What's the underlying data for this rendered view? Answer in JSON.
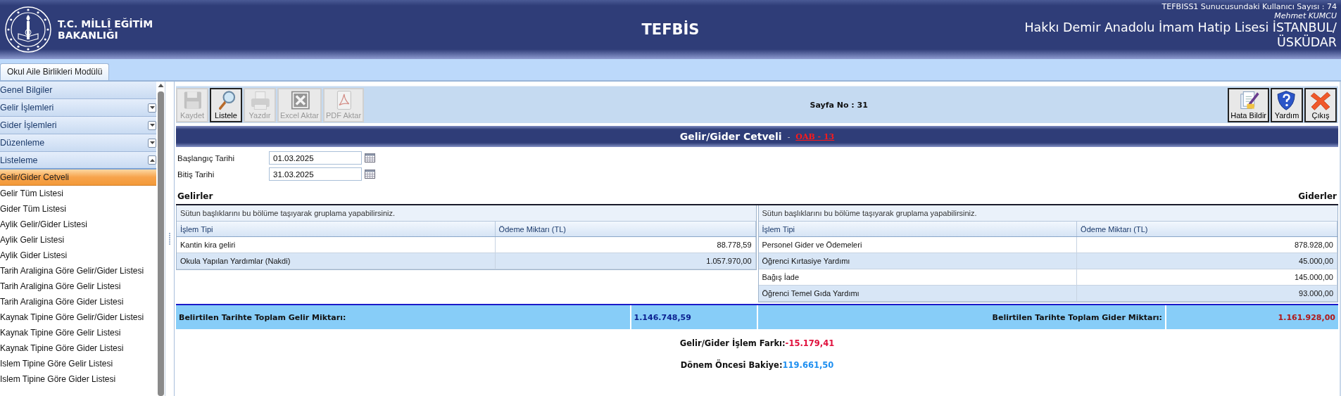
{
  "header": {
    "logo_lines": [
      "T.C. MİLLÎ EĞİTİM",
      "BAKANLIĞI"
    ],
    "app_title": "TEFBİS",
    "user_count": "TEFBISS1 Sunucusundaki Kullanıcı Sayısı : 74",
    "user": "Mehmet KUMCU",
    "school_lines": [
      "Hakkı Demir Anadolu İmam Hatip Lisesi İSTANBUL/",
      "ÜSKÜDAR"
    ]
  },
  "tabs": [
    {
      "label": "Okul Aile Birlikleri Modülü",
      "selected": true
    }
  ],
  "sidebar": {
    "sections": [
      {
        "label": "Genel Bilgiler",
        "kind": "link",
        "expanded": false
      },
      {
        "label": "Gelir İşlemleri",
        "kind": "group",
        "expanded": false
      },
      {
        "label": "Gider İşlemleri",
        "kind": "group",
        "expanded": false
      },
      {
        "label": "Düzenleme",
        "kind": "group",
        "expanded": false
      },
      {
        "label": "Listeleme",
        "kind": "group",
        "expanded": true,
        "items": [
          {
            "label": "Gelir/Gider Cetveli",
            "selected": true
          },
          {
            "label": "Gelir Tüm Listesi",
            "selected": false
          },
          {
            "label": "Gider Tüm Listesi",
            "selected": false
          },
          {
            "label": "Aylik Gelir/Gider Listesi",
            "selected": false
          },
          {
            "label": "Aylik Gelir Listesi",
            "selected": false
          },
          {
            "label": "Aylik Gider Listesi",
            "selected": false
          },
          {
            "label": "Tarih Araligina Göre Gelir/Gider Listesi",
            "selected": false
          },
          {
            "label": "Tarih Araligina Göre Gelir Listesi",
            "selected": false
          },
          {
            "label": "Tarih Araligina Göre Gider Listesi",
            "selected": false
          },
          {
            "label": "Kaynak Tipine Göre Gelir/Gider Listesi",
            "selected": false
          },
          {
            "label": "Kaynak Tipine Göre Gelir Listesi",
            "selected": false
          },
          {
            "label": "Kaynak Tipine Göre Gider Listesi",
            "selected": false
          },
          {
            "label": "Islem Tipine Göre Gelir Listesi",
            "selected": false
          },
          {
            "label": "Islem Tipine Göre Gider Listesi",
            "selected": false
          }
        ]
      }
    ]
  },
  "toolbar": {
    "left_buttons": [
      {
        "label": "Kaydet",
        "kind": "save",
        "disabled": true
      },
      {
        "label": "Listele",
        "kind": "list",
        "disabled": false
      },
      {
        "label": "Yazdır",
        "kind": "print",
        "disabled": true
      },
      {
        "label": "Excel Aktar",
        "kind": "excel",
        "disabled": true
      },
      {
        "label": "PDF Aktar",
        "kind": "pdf",
        "disabled": true
      }
    ],
    "page_no": "Sayfa No : 31",
    "right_buttons": [
      {
        "label": "Hata Bildir",
        "kind": "report",
        "disabled": false
      },
      {
        "label": "Yardım",
        "kind": "help",
        "disabled": false
      },
      {
        "label": "Çıkış",
        "kind": "exit",
        "disabled": false
      }
    ]
  },
  "report": {
    "title": "Gelir/Gider Cetveli",
    "separator": "-",
    "code": "OAB - 13",
    "date_fields": [
      {
        "label": "Başlangıç Tarihi",
        "value": "01.03.2025"
      },
      {
        "label": "Bitiş Tarihi",
        "value": "31.03.2025"
      }
    ],
    "income": {
      "title": "Gelirler",
      "group_hint": "Sütun başlıklarını bu bölüme taşıyarak gruplama yapabilirsiniz.",
      "columns": [
        "İşlem Tipi",
        "Ödeme Miktarı (TL)"
      ],
      "rows": [
        [
          "Kantin kira geliri",
          "88.778,59"
        ],
        [
          "Okula Yapılan Yardımlar (Nakdi)",
          "1.057.970,00"
        ]
      ],
      "total_label": "Belirtilen Tarihte Toplam Gelir Miktarı:",
      "total_value": "1.146.748,59"
    },
    "expense": {
      "title": "Giderler",
      "group_hint": "Sütun başlıklarını bu bölüme taşıyarak gruplama yapabilirsiniz.",
      "columns": [
        "İşlem Tipi",
        "Ödeme Miktarı (TL)"
      ],
      "rows": [
        [
          "Personel Gider ve Ödemeleri",
          "878.928,00"
        ],
        [
          "Öğrenci Kırtasiye Yardımı",
          "45.000,00"
        ],
        [
          "Bağış İade",
          "145.000,00"
        ],
        [
          "Öğrenci Temel Gıda Yardımı",
          "93.000,00"
        ]
      ],
      "total_label": "Belirtilen Tarihte Toplam Gider Miktarı:",
      "total_value": "1.161.928,00"
    },
    "summary": [
      {
        "label": "Gelir/Gider İşlem Farkı:",
        "value": "-15.179,41",
        "color": "#e0103c"
      },
      {
        "label": "Dönem Öncesi Bakiye:",
        "value": "119.661,50",
        "color": "#1e8ff0"
      }
    ]
  }
}
